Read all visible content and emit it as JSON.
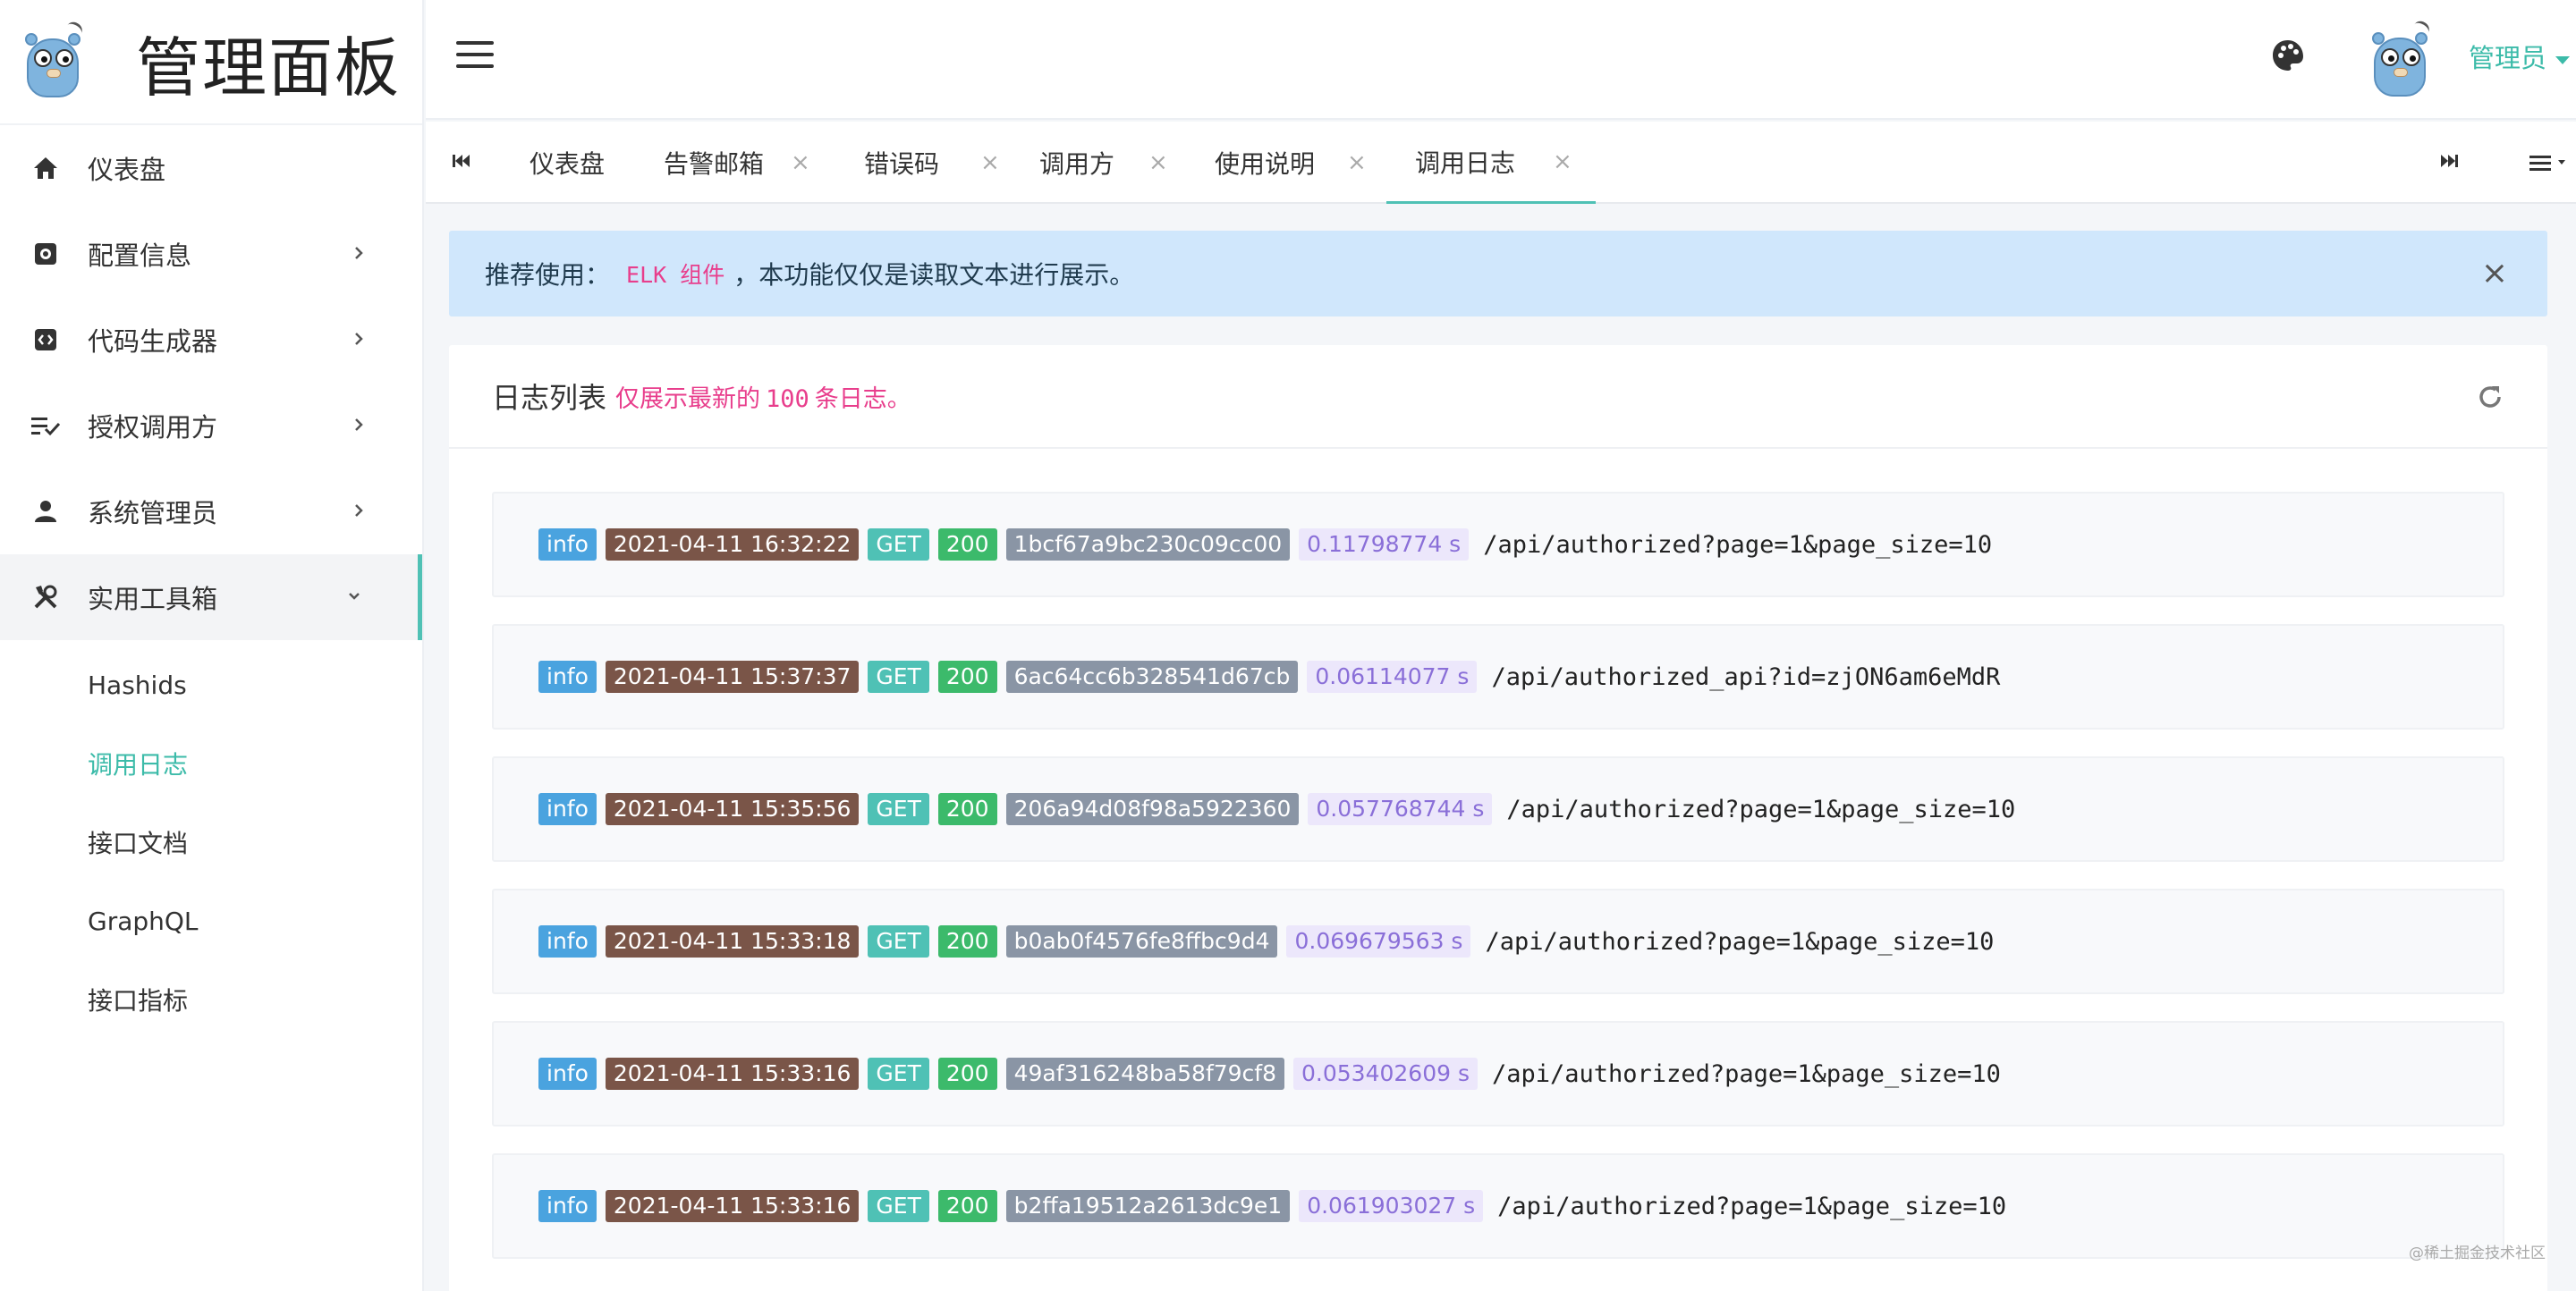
{
  "brand": {
    "title": "管理面板"
  },
  "sidebar": {
    "items": [
      {
        "label": "仪表盘",
        "icon": "home-icon"
      },
      {
        "label": "配置信息",
        "icon": "gear-icon"
      },
      {
        "label": "代码生成器",
        "icon": "code-icon"
      },
      {
        "label": "授权调用方",
        "icon": "list-check-icon"
      },
      {
        "label": "系统管理员",
        "icon": "user-icon"
      },
      {
        "label": "实用工具箱",
        "icon": "tools-icon"
      }
    ],
    "submenu": [
      {
        "label": "Hashids"
      },
      {
        "label": "调用日志"
      },
      {
        "label": "接口文档"
      },
      {
        "label": "GraphQL"
      },
      {
        "label": "接口指标"
      }
    ]
  },
  "topbar": {
    "user_name": "管理员"
  },
  "tabs": [
    {
      "label": "仪表盘"
    },
    {
      "label": "告警邮箱",
      "close": "×"
    },
    {
      "label": "错误码",
      "close": "×"
    },
    {
      "label": "调用方",
      "close": "×"
    },
    {
      "label": "使用说明",
      "close": "×"
    },
    {
      "label": "调用日志",
      "close": "×"
    }
  ],
  "alert": {
    "prefix": "推荐使用：",
    "code": "ELK 组件",
    "suffix": "，本功能仅仅是读取文本进行展示。",
    "close": "×"
  },
  "card": {
    "title": "日志列表",
    "sub_prefix": "仅展示最新的",
    "sub_num": "100",
    "sub_suffix": "条日志。"
  },
  "logs": [
    {
      "level": "info",
      "time": "2021-04-11 16:32:22",
      "method": "GET",
      "status": "200",
      "id": "1bcf67a9bc230c09cc00",
      "duration": "0.11798774 s",
      "path": "/api/authorized?page=1&page_size=10"
    },
    {
      "level": "info",
      "time": "2021-04-11 15:37:37",
      "method": "GET",
      "status": "200",
      "id": "6ac64cc6b328541d67cb",
      "duration": "0.06114077 s",
      "path": "/api/authorized_api?id=zjON6am6eMdR"
    },
    {
      "level": "info",
      "time": "2021-04-11 15:35:56",
      "method": "GET",
      "status": "200",
      "id": "206a94d08f98a5922360",
      "duration": "0.057768744 s",
      "path": "/api/authorized?page=1&page_size=10"
    },
    {
      "level": "info",
      "time": "2021-04-11 15:33:18",
      "method": "GET",
      "status": "200",
      "id": "b0ab0f4576fe8ffbc9d4",
      "duration": "0.069679563 s",
      "path": "/api/authorized?page=1&page_size=10"
    },
    {
      "level": "info",
      "time": "2021-04-11 15:33:16",
      "method": "GET",
      "status": "200",
      "id": "49af316248ba58f79cf8",
      "duration": "0.053402609 s",
      "path": "/api/authorized?page=1&page_size=10"
    },
    {
      "level": "info",
      "time": "2021-04-11 15:33:16",
      "method": "GET",
      "status": "200",
      "id": "b2ffa19512a2613dc9e1",
      "duration": "0.061903027 s",
      "path": "/api/authorized?page=1&page_size=10"
    }
  ],
  "watermark": "@稀土掘金技术社区",
  "colors": {
    "accent": "#3cbba9",
    "alert_bg": "#d0e7fc",
    "code_pink": "#e83e8c"
  }
}
